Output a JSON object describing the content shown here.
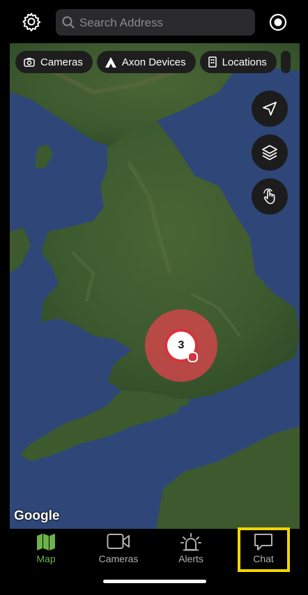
{
  "header": {
    "search_placeholder": "Search Address"
  },
  "filters": [
    {
      "label": "Cameras",
      "icon": "camera-icon"
    },
    {
      "label": "Axon Devices",
      "icon": "axon-logo-icon"
    },
    {
      "label": "Locations",
      "icon": "building-icon"
    }
  ],
  "map": {
    "cluster_count": "3",
    "attribution": "Google",
    "buttons": [
      "navigation-arrow-icon",
      "layers-icon",
      "hand-pointer-icon"
    ]
  },
  "tabs": [
    {
      "label": "Map",
      "icon": "map-icon",
      "active": true
    },
    {
      "label": "Cameras",
      "icon": "video-camera-icon",
      "active": false
    },
    {
      "label": "Alerts",
      "icon": "alert-beacon-icon",
      "active": false
    },
    {
      "label": "Chat",
      "icon": "chat-bubble-icon",
      "active": false
    }
  ],
  "colors": {
    "active_tab": "#6cb34a",
    "cluster": "#d8323d",
    "highlight": "#f2d600",
    "sea": "#2f4a7c",
    "land": "#3e5a2e"
  }
}
